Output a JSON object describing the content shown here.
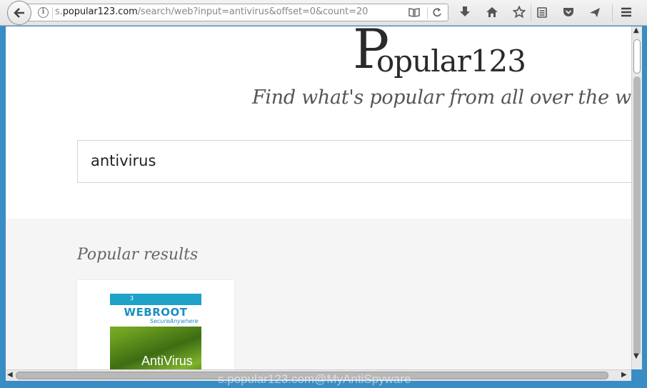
{
  "browser": {
    "url_prefix": "s.",
    "url_domain": "popular123.com",
    "url_path": "/search/web?input=antivirus&offset=0&count=20"
  },
  "page": {
    "logo_initial": "P",
    "logo_rest": "opular123",
    "tagline": "Find what's popular from all over the world",
    "search_value": "antivirus",
    "results_heading": "Popular results"
  },
  "product": {
    "brand": "WEBROOT",
    "sub_brand": "SecureAnywhere",
    "name": "AntiVirus",
    "badge": "3"
  },
  "watermark": "s.popular123.com@MyAntiSpyware",
  "colors": {
    "frame": "#3a8cc4",
    "brand_blue": "#1a8fbf",
    "product_green": "#6ea021"
  }
}
